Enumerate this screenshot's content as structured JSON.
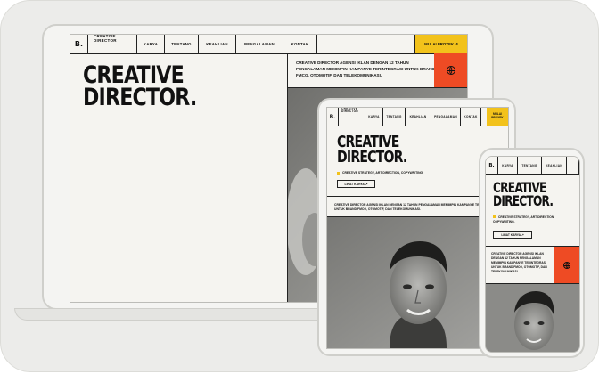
{
  "site": {
    "logo": "B.",
    "brand_line1": "CREATIVE",
    "brand_line2": "DIRECTOR",
    "nav": [
      "KARYA",
      "TENTANG",
      "KEAHLIAN",
      "PENGALAMAN",
      "KONTAK"
    ],
    "cta": "MULAI PROYEK ↗",
    "cta_tablet_line1": "MULAI",
    "cta_tablet_line2": "PROYEK",
    "headline_line1": "CREATIVE",
    "headline_line2": "DIRECTOR.",
    "intro": "CREATIVE DIRECTOR AGENSI IKLAN DENGAN 12 TAHUN PENGALAMAN MEMIMPIN KAMPANYE TERINTEGRASI UNTUK BRAND FMCG, OTOMOTIF, DAN TELEKOMUNIKASI.",
    "tagline": "CREATIVE STRATEGY, ART DIRECTION, COPYWRITING.",
    "tagline_phone_line1": "CREATIVE STRATEGY, ART DIRECTION,",
    "tagline_phone_line2": "COPYWRITING.",
    "work_button": "LIHAT KARYA ↗",
    "globe_icon": "globe-icon"
  },
  "colors": {
    "accent_yellow": "#f2c21b",
    "accent_red": "#ee4b24",
    "background": "#f5f4f0"
  }
}
